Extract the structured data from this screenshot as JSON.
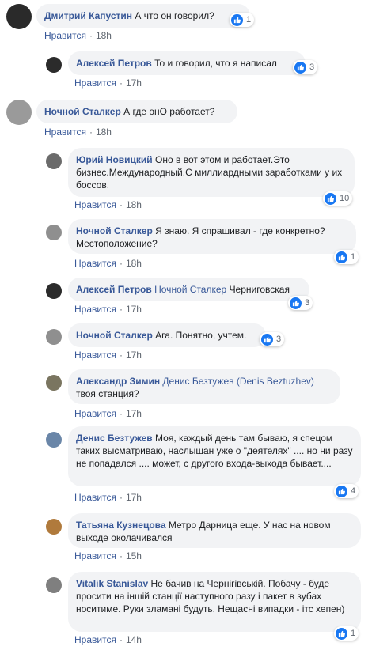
{
  "like_label": "Нравится",
  "separator": "·",
  "comments": [
    {
      "author": "Дмитрий Капустин",
      "mention": "",
      "text": "А что он говорил?",
      "time": "18h",
      "reactions": "1"
    },
    {
      "author": "Алексей Петров",
      "mention": "",
      "text": "То и говорил, что я написал",
      "time": "17h",
      "reactions": "3"
    },
    {
      "author": "Ночной Сталкер",
      "mention": "",
      "text": "А где онО работает?",
      "time": "18h",
      "reactions": ""
    },
    {
      "author": "Юрий Новицкий",
      "mention": "",
      "text": "Оно в вот этом и работает.Это бизнес.Международный.С миллиардными заработками у их боссов.",
      "time": "18h",
      "reactions": "10"
    },
    {
      "author": "Ночной Сталкер",
      "mention": "",
      "text": "Я знаю. Я спрашивал - где конкретно? Местоположение?",
      "time": "18h",
      "reactions": "1"
    },
    {
      "author": "Алексей Петров",
      "mention": "Ночной Сталкер",
      "text": "Черниговская",
      "time": "17h",
      "reactions": "3"
    },
    {
      "author": "Ночной Сталкер",
      "mention": "",
      "text": "Ага. Понятно, учтем.",
      "time": "17h",
      "reactions": "3"
    },
    {
      "author": "Александр Зимин",
      "mention": "Денис Безтужев (Denis Beztuzhev)",
      "text": "твоя станция?",
      "time": "17h",
      "reactions": ""
    },
    {
      "author": "Денис Безтужев",
      "mention": "",
      "text": "Моя, каждый день там бываю, я спецом таких высматриваю, наслышан уже о \"деятелях\" .... но ни разу не попадался .... может, с другого входа-выхода бывает....",
      "time": "17h",
      "reactions": "4"
    },
    {
      "author": "Татьяна Кузнецова",
      "mention": "",
      "text": "Метро Дарница еще. У нас на новом выходе околачивался",
      "time": "15h",
      "reactions": ""
    },
    {
      "author": "Vitalik Stanislav",
      "mention": "",
      "text": "Не бачив на Чернігівській. Побачу - буде просити на іншій станції наступного разу і пакет в зубах носитиме. Руки зламані будуть. Нещасні випадки - ітс хепен)",
      "time": "14h",
      "reactions": "1"
    }
  ]
}
